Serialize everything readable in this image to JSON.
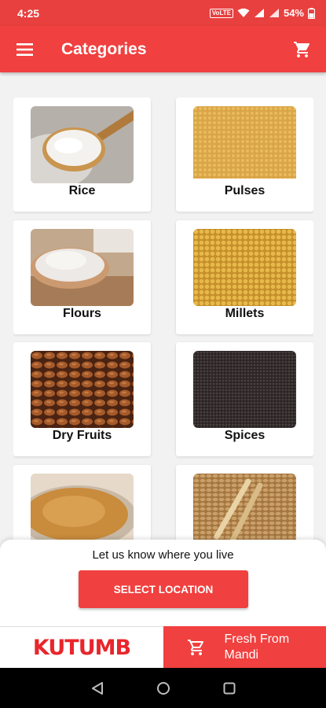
{
  "status_bar": {
    "time": "4:25",
    "volte": "VoLTE",
    "battery": "54%"
  },
  "app_bar": {
    "title": "Categories"
  },
  "categories": [
    {
      "label": "Rice",
      "image": "rice-image"
    },
    {
      "label": "Pulses",
      "image": "pulses-image"
    },
    {
      "label": "Flours",
      "image": "flour-image"
    },
    {
      "label": "Millets",
      "image": "millets-image"
    },
    {
      "label": "Dry Fruits",
      "image": "almonds-image"
    },
    {
      "label": "Spices",
      "image": "spices-image"
    },
    {
      "label": "",
      "image": "powder-image"
    },
    {
      "label": "",
      "image": "wheat-image"
    }
  ],
  "location_sheet": {
    "prompt": "Let us know where you live",
    "button": "SELECT LOCATION"
  },
  "bottom_bar": {
    "logo_text": "KUTUMB",
    "fresh_label": "Fresh From Mandi"
  },
  "colors": {
    "primary": "#f0403f",
    "status_bar": "#e8403f",
    "background": "#f2f2f2"
  }
}
